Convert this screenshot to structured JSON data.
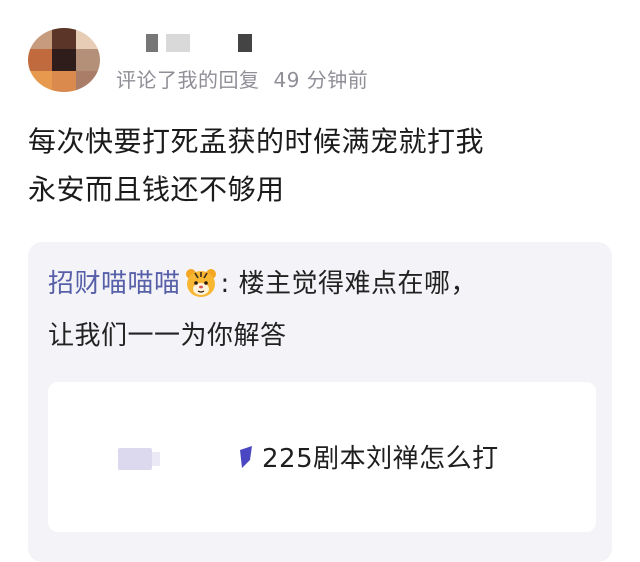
{
  "header": {
    "meta_action": "评论了我的回复",
    "meta_time": "49 分钟前"
  },
  "comment": {
    "lines": [
      "每次快要打死孟获的时候满宠就打我",
      "永安而且钱还不够用"
    ]
  },
  "quote": {
    "user": "招财喵喵喵",
    "icon": "tiger-face-icon",
    "colon": ":",
    "line1_text": "楼主觉得难点在哪，",
    "line2_text": "让我们一一为你解答"
  },
  "link_card": {
    "title": "225剧本刘禅怎么打"
  },
  "colors": {
    "username": "#575fa8",
    "meta": "#8f8f97",
    "quote_bg": "#f4f4f8",
    "card_bg": "#ffffff"
  }
}
